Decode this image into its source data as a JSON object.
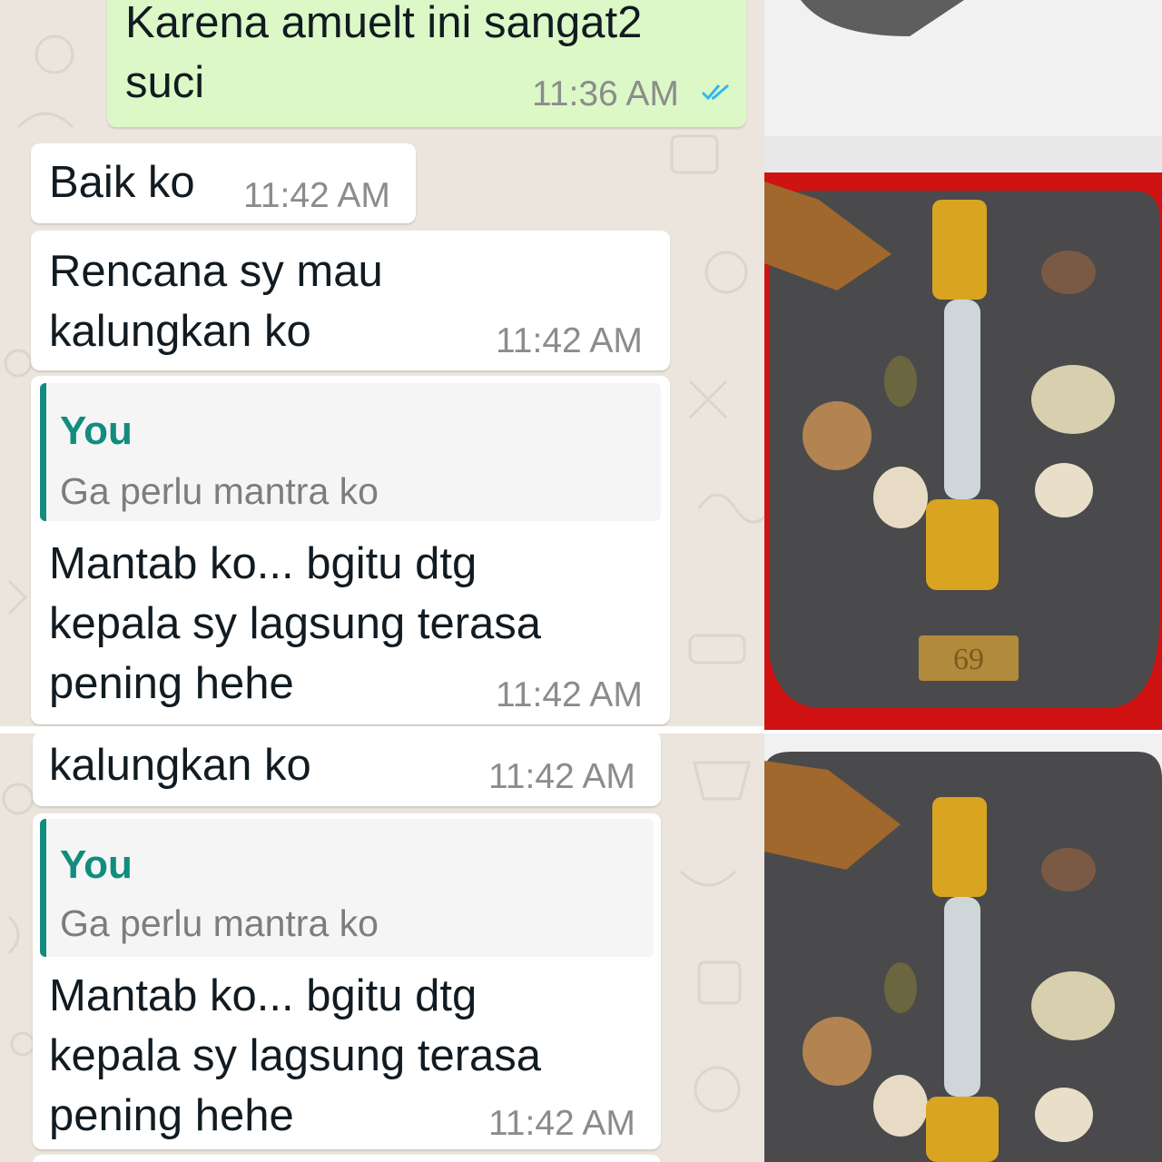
{
  "colors": {
    "outgoing_bubble": "#dcf8c6",
    "incoming_bubble": "#ffffff",
    "chat_background": "#ece5dd",
    "quote_accent": "#128c7e",
    "read_ticks": "#34b7f1",
    "tray_red": "#d81c1c"
  },
  "messages": [
    {
      "direction": "outgoing",
      "text": "Karena amuelt ini sangat2\nsuci",
      "time": "11:36 AM",
      "status_icon": "double-check-read-icon"
    },
    {
      "direction": "incoming",
      "text": "Baik ko",
      "time": "11:42 AM"
    },
    {
      "direction": "incoming",
      "text": "Rencana sy mau\nkalungkan ko",
      "time": "11:42 AM"
    },
    {
      "direction": "incoming",
      "quote": {
        "author": "You",
        "text": "Ga perlu mantra ko"
      },
      "text": "Mantab ko... bgitu dtg\nkepala sy lagsung terasa\npening hehe",
      "time": "11:42 AM"
    }
  ],
  "messages_repeat": [
    {
      "direction": "incoming",
      "text": "kalungkan ko",
      "time": "11:42 AM"
    },
    {
      "direction": "incoming",
      "quote": {
        "author": "You",
        "text": "Ga perlu mantra ko"
      },
      "text": "Mantab ko... bgitu dtg\nkepala sy lagsung terasa\npening hehe",
      "time": "11:42 AM"
    }
  ],
  "amulet_photo": {
    "icon": "amulet-photo",
    "plaque_label": "69"
  }
}
